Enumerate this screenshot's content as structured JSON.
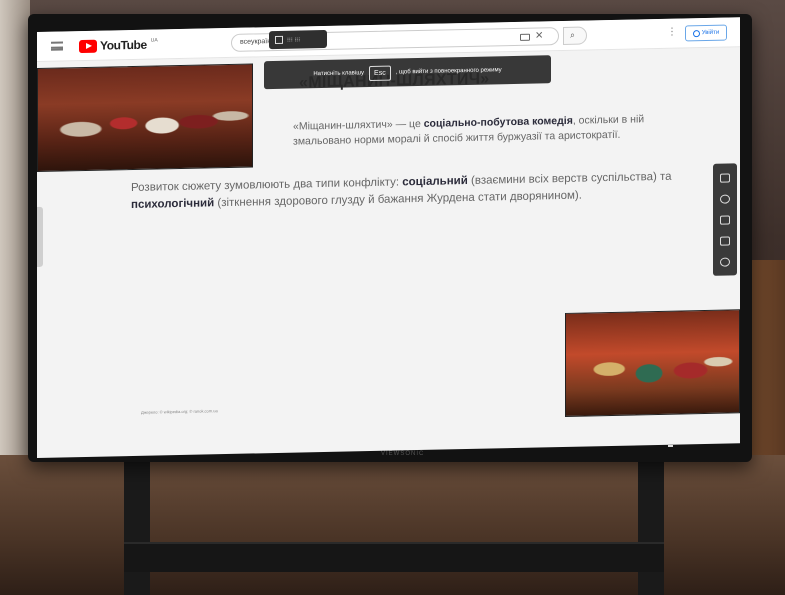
{
  "youtube": {
    "logo_text": "YouTube",
    "logo_sup": "UA",
    "search_value": "всеукраїнська школа",
    "search_icon": "search-icon",
    "signin_label": "Увійти"
  },
  "fullscreen_chip": {
    "label": "⁝⁝⁝ ⁝⁝⁝"
  },
  "esc_toast": {
    "prefix": "Натисніть клавішу",
    "key": "Esc",
    "suffix": ", щоб вийти з повноекранного режиму"
  },
  "slide": {
    "title": "«МІЩАНИН-ШЛЯХТИЧ»",
    "p1_a": "«Міщанин-шляхтич» — це ",
    "p1_b": "соціально-побутова комедія",
    "p1_c": ", оскільки в ній змальовано норми моралі й спосіб життя буржуазії та аристократії.",
    "p2_a": "Розвиток сюжету зумовлюють два типи конфлікту: ",
    "p2_b": "соціальний",
    "p2_c": " (взаємини всіх верств суспільства) та ",
    "p2_d": "психологічний",
    "p2_e": " (зіткнення здорового глузду й бажання Журдена стати дворянином).",
    "caption": "Джерело: © wikipedia.org; © ranok.com.ua"
  },
  "tv": {
    "brand": "VIEWSONIC"
  }
}
